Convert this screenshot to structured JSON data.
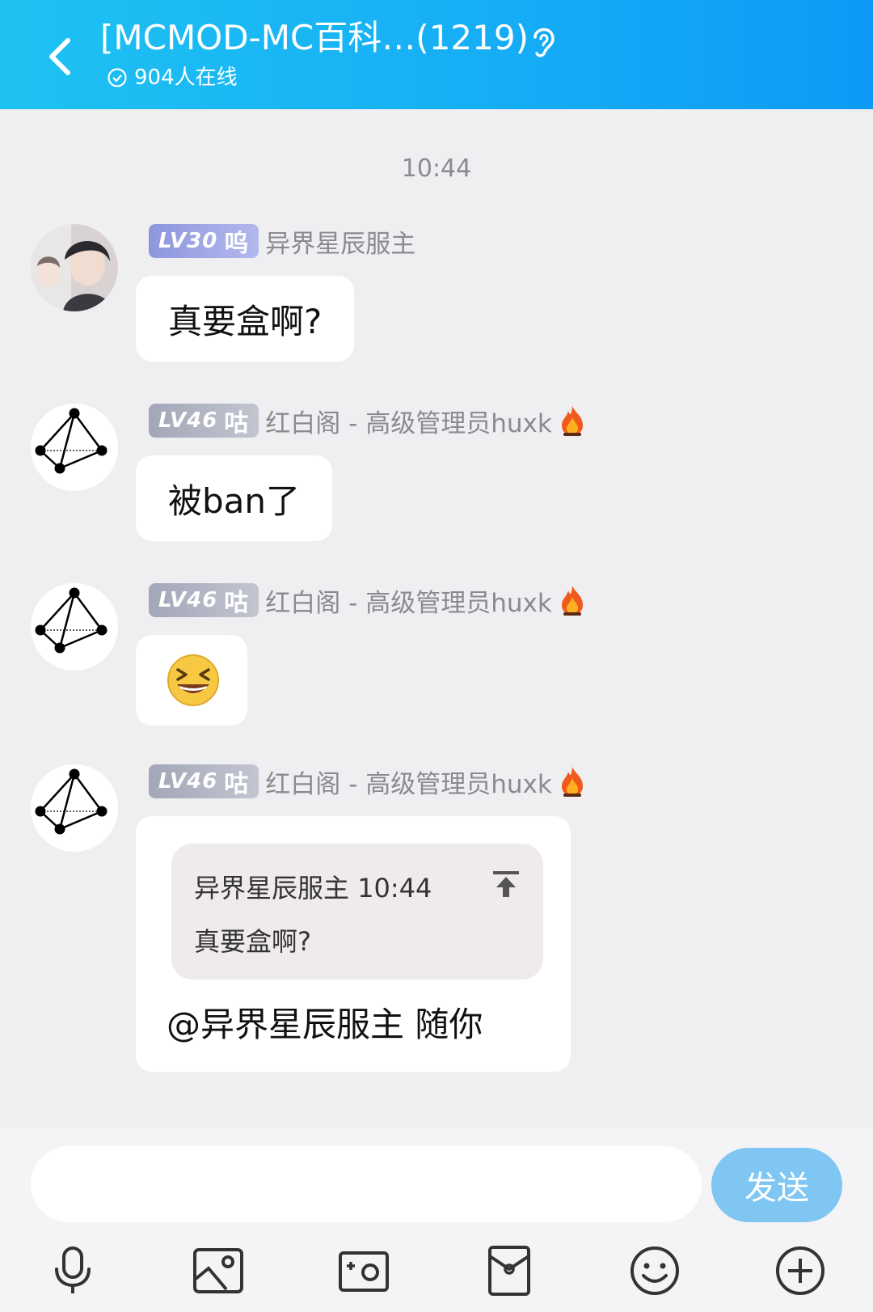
{
  "header": {
    "title": "[MCMOD-MC百科…(1219)",
    "online_text": "904人在线"
  },
  "chat": {
    "time": "10:44",
    "messages": [
      {
        "level": "LV30",
        "rank": "呜",
        "name": "异界星辰服主",
        "text": "真要盒啊?"
      },
      {
        "level": "LV46",
        "rank": "咕",
        "name": "红白阁 - 高级管理员huxk",
        "text": "被ban了"
      },
      {
        "level": "LV46",
        "rank": "咕",
        "name": "红白阁 - 高级管理员huxk",
        "emoji": "laughing-emoji"
      },
      {
        "level": "LV46",
        "rank": "咕",
        "name": "红白阁 - 高级管理员huxk",
        "quote": {
          "author": "异界星辰服主",
          "time": "10:44",
          "text": "真要盒啊?"
        },
        "text": "@异界星辰服主 随你"
      }
    ]
  },
  "input": {
    "placeholder": "",
    "send_label": "发送"
  },
  "toolbar": [
    "microphone-icon",
    "image-icon",
    "camera-icon",
    "red-packet-icon",
    "emoji-icon",
    "plus-icon"
  ],
  "colors": {
    "header": "#17b0f5",
    "send": "#7fc6f3",
    "background": "#efeff1"
  }
}
